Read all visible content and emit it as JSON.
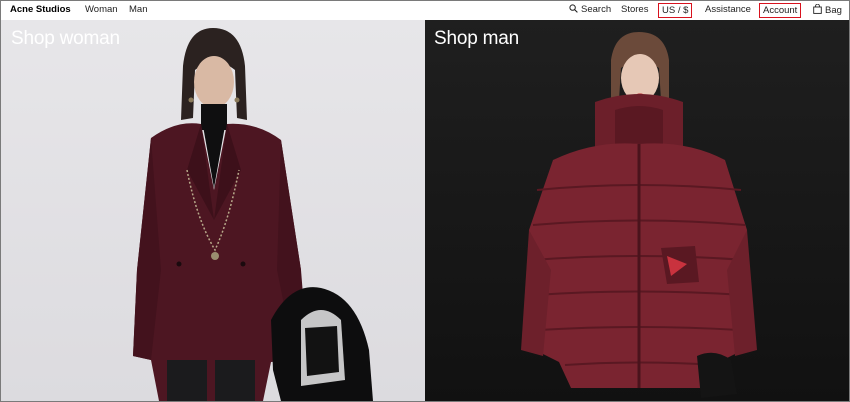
{
  "nav": {
    "brand": "Acne Studios",
    "woman": "Woman",
    "man": "Man",
    "search": "Search",
    "stores": "Stores",
    "currency": "US / $",
    "assistance": "Assistance",
    "account": "Account",
    "bag": "Bag"
  },
  "panels": {
    "woman_title": "Shop woman",
    "man_title": "Shop man"
  },
  "colors": {
    "highlight_border": "#d8121e",
    "woman_background": "#e2e1e5",
    "man_background": "#161616",
    "garment_burgundy": "#5a1a26",
    "puffer_red": "#7a2430"
  }
}
